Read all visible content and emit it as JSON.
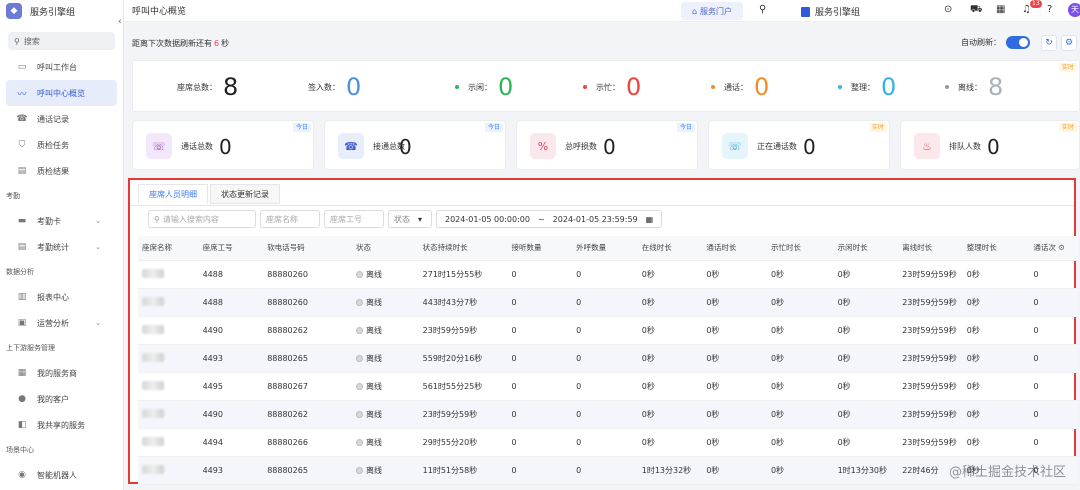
{
  "sidebar": {
    "brand": "服务引擎组",
    "search": "搜索",
    "items_top": [
      {
        "label": "呼叫工作台",
        "icon": "monitor-icon"
      },
      {
        "label": "呼叫中心概览",
        "icon": "chart-icon",
        "active": true
      },
      {
        "label": "通话记录",
        "icon": "phone-icon"
      },
      {
        "label": "质检任务",
        "icon": "shield-icon"
      },
      {
        "label": "质检结果",
        "icon": "document-icon"
      }
    ],
    "group_attendance": "考勤",
    "attendance": [
      {
        "label": "考勤卡"
      },
      {
        "label": "考勤统计"
      }
    ],
    "group_analysis": "数据分析",
    "analysis": [
      {
        "label": "报表中心"
      },
      {
        "label": "运营分析"
      }
    ],
    "group_updown": "上下游服务管理",
    "updown": [
      {
        "label": "我的服务商"
      },
      {
        "label": "我的客户"
      },
      {
        "label": "我共享的服务"
      }
    ],
    "group_scene": "场景中心",
    "scene": [
      {
        "label": "智能机器人"
      }
    ]
  },
  "topbar": {
    "title": "呼叫中心概览",
    "portal": "服务门户",
    "org": "服务引擎组",
    "badge": "13",
    "avatar": "天"
  },
  "refresh": {
    "prefix": "距离下次数据刷新还有",
    "seconds": "6",
    "suffix": "秒",
    "auto_label": "自动刷新：",
    "auto_on": true
  },
  "stats": {
    "tag": "实时",
    "items": [
      {
        "label": "座席总数：",
        "value": "8",
        "color": "#222222"
      },
      {
        "label": "签入数：",
        "value": "0",
        "color": "#4a90e2"
      },
      {
        "label": "示闲：",
        "value": "0",
        "color": "#2fb35a",
        "dot": "#2fb35a"
      },
      {
        "label": "示忙：",
        "value": "0",
        "color": "#f04343",
        "dot": "#f04343"
      },
      {
        "label": "通话：",
        "value": "0",
        "color": "#f08c2b",
        "dot": "#f08c2b"
      },
      {
        "label": "整理：",
        "value": "0",
        "color": "#34b3e4",
        "dot": "#34b3e4"
      },
      {
        "label": "离线：",
        "value": "8",
        "color": "#aab0b8",
        "dot": "#9a9a9a"
      }
    ]
  },
  "cards": [
    {
      "label": "通话总数",
      "value": "0",
      "tag": "今日",
      "icon": "phone-icon",
      "color": "#8e44ad",
      "bg": "#f3e8fb"
    },
    {
      "label": "接通总数",
      "value": "0",
      "tag": "今日",
      "icon": "phone-in-icon",
      "color": "#3f5bd8",
      "bg": "#e8edfb"
    },
    {
      "label": "总呼损数",
      "value": "0",
      "tag": "今日",
      "icon": "percent-icon",
      "color": "#e0405a",
      "bg": "#fbe8ec"
    },
    {
      "label": "正在通话数",
      "value": "0",
      "tag": "实时",
      "icon": "phone-active-icon",
      "color": "#2aa3d8",
      "bg": "#e6f5fb"
    },
    {
      "label": "排队人数",
      "value": "0",
      "tag": "实时",
      "icon": "queue-icon",
      "color": "#e0405a",
      "bg": "#fbe8ec"
    }
  ],
  "panel": {
    "tabs": [
      "座席人员明细",
      "状态更新记录"
    ],
    "filters": {
      "search_placeholder": "请输入搜索内容",
      "name_placeholder": "座席名称",
      "id_placeholder": "座席工号",
      "status": "状态",
      "date_start": "2024-01-05 00:00:00",
      "date_sep": "~",
      "date_end": "2024-01-05 23:59:59"
    },
    "columns": [
      "座席名称",
      "座席工号",
      "软电话号码",
      "状态",
      "状态持续时长",
      "接听数量",
      "外呼数量",
      "在线时长",
      "通话时长",
      "示忙时长",
      "示闲时长",
      "离线时长",
      "整理时长",
      "通话次"
    ],
    "rows": [
      [
        "",
        "4488",
        "88880260",
        "离线",
        "271时15分55秒",
        "0",
        "0",
        "0秒",
        "0秒",
        "0秒",
        "0秒",
        "23时59分59秒",
        "0秒",
        "0"
      ],
      [
        "",
        "4488",
        "88880260",
        "离线",
        "443时43分7秒",
        "0",
        "0",
        "0秒",
        "0秒",
        "0秒",
        "0秒",
        "23时59分59秒",
        "0秒",
        "0"
      ],
      [
        "",
        "4490",
        "88880262",
        "离线",
        "23时59分59秒",
        "0",
        "0",
        "0秒",
        "0秒",
        "0秒",
        "0秒",
        "23时59分59秒",
        "0秒",
        "0"
      ],
      [
        "",
        "4493",
        "88880265",
        "离线",
        "559时20分16秒",
        "0",
        "0",
        "0秒",
        "0秒",
        "0秒",
        "0秒",
        "23时59分59秒",
        "0秒",
        "0"
      ],
      [
        "",
        "4495",
        "88880267",
        "离线",
        "561时55分25秒",
        "0",
        "0",
        "0秒",
        "0秒",
        "0秒",
        "0秒",
        "23时59分59秒",
        "0秒",
        "0"
      ],
      [
        "",
        "4490",
        "88880262",
        "离线",
        "23时59分59秒",
        "0",
        "0",
        "0秒",
        "0秒",
        "0秒",
        "0秒",
        "23时59分59秒",
        "0秒",
        "0"
      ],
      [
        "",
        "4494",
        "88880266",
        "离线",
        "29时55分20秒",
        "0",
        "0",
        "0秒",
        "0秒",
        "0秒",
        "0秒",
        "23时59分59秒",
        "0秒",
        "0"
      ],
      [
        "",
        "4493",
        "88880265",
        "离线",
        "11时51分58秒",
        "0",
        "0",
        "1时13分32秒",
        "0秒",
        "0秒",
        "1时13分30秒",
        "22时46分",
        "0秒",
        "0"
      ]
    ]
  },
  "watermark": "@稀土掘金技术社区"
}
